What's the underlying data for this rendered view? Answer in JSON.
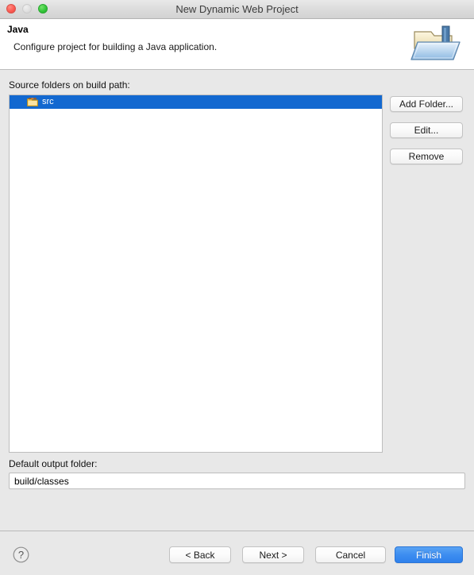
{
  "window": {
    "title": "New Dynamic Web Project",
    "traffic_lights": [
      {
        "name": "close",
        "color": "#fc5b53"
      },
      {
        "name": "minimize",
        "color": "#e0e0e0"
      },
      {
        "name": "maximize",
        "color": "#34c63a"
      }
    ]
  },
  "header": {
    "title": "Java",
    "description": "Configure project for building a Java application.",
    "icon": "java-build-path-folder-icon"
  },
  "main": {
    "source_folders_label": "Source folders on build path:",
    "folders": [
      {
        "icon": "source-folder-icon",
        "label": "src",
        "selected": true
      }
    ],
    "side_buttons": [
      {
        "label": "Add Folder...",
        "name": "add-folder-button"
      },
      {
        "label": "Edit...",
        "name": "edit-button"
      },
      {
        "label": "Remove",
        "name": "remove-button"
      }
    ],
    "output_folder_label": "Default output folder:",
    "output_folder_value": "build/classes",
    "output_folder_placeholder": "Default output folder"
  },
  "footer": {
    "help_icon": "help-question-icon",
    "back_label": "< Back",
    "next_label": "Next >",
    "cancel_label": "Cancel",
    "finish_label": "Finish"
  },
  "colors": {
    "selection_blue": "#1268d0",
    "primary_button_blue": "#3d8df0",
    "dialog_background": "#e8e8e8",
    "header_background": "#ffffff"
  }
}
